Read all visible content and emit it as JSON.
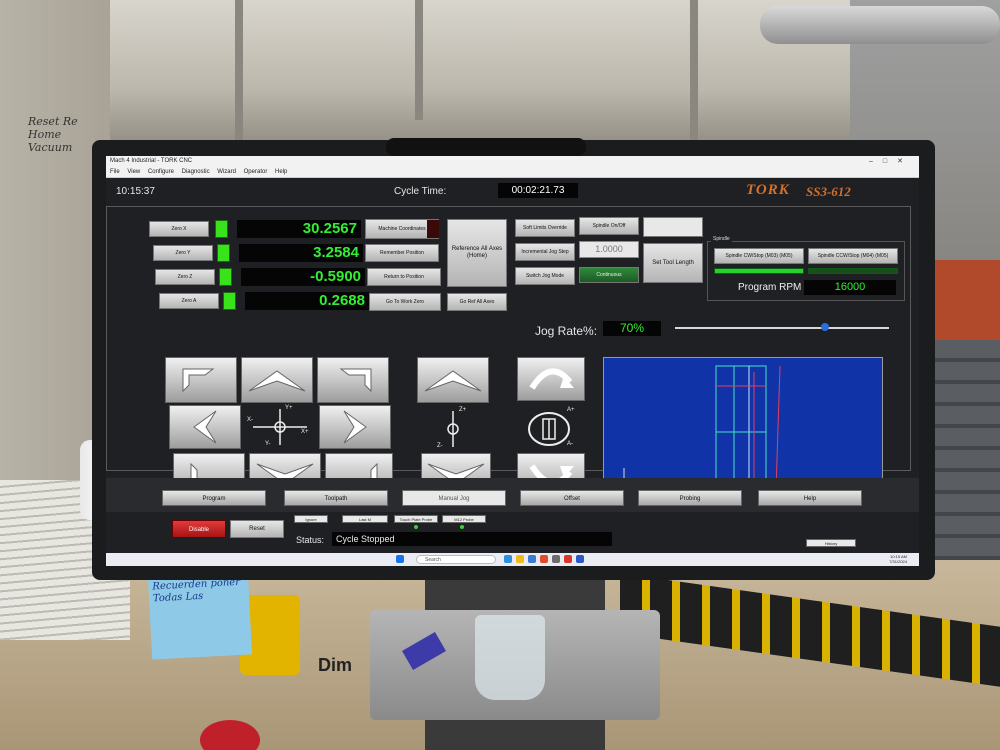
{
  "window": {
    "title": "Mach 4 Industrial - TORK CNC",
    "menu": [
      "File",
      "View",
      "Configure",
      "Diagnostic",
      "Wizard",
      "Operator",
      "Help"
    ]
  },
  "header": {
    "clock": "10:15:37",
    "cycle_time_label": "Cycle Time:",
    "cycle_time_value": "00:02:21.73",
    "brand": "TORK",
    "model": "SS3-612"
  },
  "axes": [
    {
      "zero_label": "Zero X",
      "value": "30.2567"
    },
    {
      "zero_label": "Zero Y",
      "value": "3.2584"
    },
    {
      "zero_label": "Zero Z",
      "value": "-0.5900"
    },
    {
      "zero_label": "Zero A",
      "value": "0.2688"
    }
  ],
  "position_buttons": {
    "machine_coords": "Machine Coordinates",
    "remember": "Remember Position",
    "return": "Return to Position",
    "goto_zero": "Go To Work Zero",
    "reference_all": "Reference All Axes (Home)",
    "goto_ref": "Go Ref All Axes"
  },
  "jog_buttons": {
    "soft_limits": "Soft Limits Override",
    "incremental": "Incremental Jog Step",
    "switch_mode": "Switch Jog Mode",
    "spindle_onoff": "Spindle On/Off",
    "step_value": "1.0000",
    "continuous": "Continuous",
    "set_tool": "Set Tool Length"
  },
  "spindle": {
    "title": "Spindle",
    "cw_label": "Spindle CW/Stop (M03)   (M05)",
    "ccw_label": "Spindle CCW/Stop (M04)   (M05)",
    "rpm_label": "Program RPM",
    "rpm_value": "16000"
  },
  "jog": {
    "rate_label": "Jog Rate%:",
    "rate_value": "70%",
    "rate_level": 0.7,
    "axis_xy": [
      "Y+",
      "X-",
      "X+",
      "Y-"
    ],
    "axis_z": [
      "Z+",
      "Z-"
    ],
    "axis_a": [
      "A+",
      "A-"
    ]
  },
  "tabs": [
    "Program",
    "Toolpath",
    "Manual Jog",
    "Offset",
    "Probing",
    "Help"
  ],
  "active_tab": "Manual Jog",
  "bottom": {
    "stop": "Disable",
    "reset": "Reset",
    "status_label": "Status:",
    "status_value": "Cycle Stopped",
    "mini": [
      "Ignore",
      "Last M",
      "Touch Plate Probe",
      "M12 Probe"
    ],
    "history": "History"
  },
  "taskbar": {
    "search": "Search",
    "time": "10:15 AM",
    "date": "7/31/2024"
  },
  "notes": {
    "wall": "Reset Re Home Vacuum",
    "sticky": "Recuerden poner Todas Las",
    "desk_tag": "Dim"
  },
  "colors": {
    "dro_green": "#33ee33",
    "brand_orange": "#d4702a",
    "toolpath_blue": "#1034a8",
    "stop_red": "#c21818"
  }
}
